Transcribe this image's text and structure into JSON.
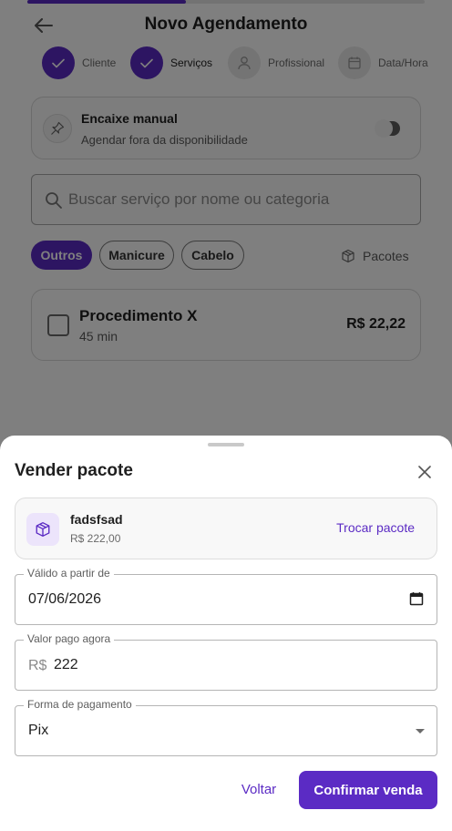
{
  "colors": {
    "accent": "#5b2bc4",
    "accent_soft": "#ece4fb",
    "overlay": "rgba(0,0,0,0.5)"
  },
  "header": {
    "title": "Novo Agendamento",
    "back_icon": "arrow-left-icon",
    "progress": 0.4
  },
  "steps": [
    {
      "label": "Cliente",
      "status": "done",
      "icon": "check-icon"
    },
    {
      "label": "Serviços",
      "status": "done",
      "icon": "check-icon"
    },
    {
      "label": "Profissional",
      "status": "todo",
      "icon": "person-icon"
    },
    {
      "label": "Data/Hora",
      "status": "todo",
      "icon": "calendar-icon"
    }
  ],
  "encaixe": {
    "title": "Encaixe manual",
    "subtitle": "Agendar fora da disponibilidade",
    "enabled": false
  },
  "search": {
    "placeholder": "Buscar serviço por nome ou categoria",
    "value": ""
  },
  "categories": [
    {
      "label": "Outros",
      "active": true
    },
    {
      "label": "Manicure",
      "active": false
    },
    {
      "label": "Cabelo",
      "active": false
    }
  ],
  "pacotes_link": "Pacotes",
  "services": [
    {
      "name": "Procedimento X",
      "duration": "45 min",
      "price": "R$ 22,22",
      "checked": false
    }
  ],
  "sheet": {
    "title": "Vender pacote",
    "package": {
      "name": "fadsfsad",
      "price": "R$ 222,00",
      "swap_label": "Trocar pacote",
      "icon": "package-icon"
    },
    "fields": {
      "valid_from": {
        "label": "Válido a partir de",
        "value": "07/06/2026"
      },
      "amount_paid": {
        "label": "Valor pago agora",
        "prefix": "R$",
        "value": "222"
      },
      "payment_method": {
        "label": "Forma de pagamento",
        "value": "Pix"
      }
    },
    "back_label": "Voltar",
    "confirm_label": "Confirmar venda"
  }
}
